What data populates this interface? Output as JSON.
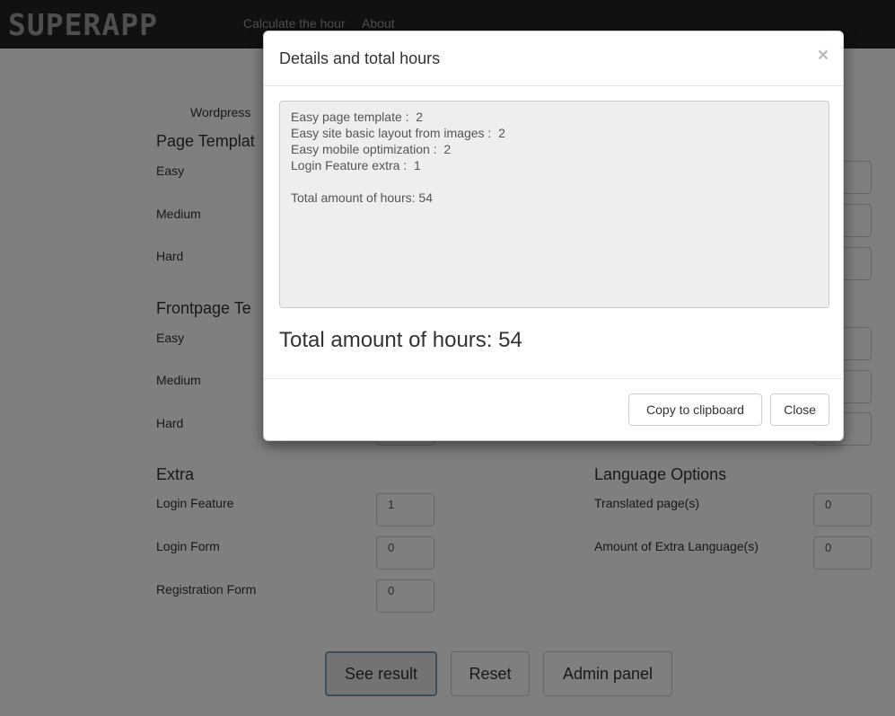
{
  "navbar": {
    "brand": "SUPERAPP",
    "links": [
      "Calculate the hour",
      "About"
    ]
  },
  "form": {
    "subtitle": "Wordpress",
    "sections": {
      "page_templates": {
        "title": "Page Templat",
        "rows": [
          "Easy",
          "Medium",
          "Hard"
        ]
      },
      "frontpage_templates": {
        "title": "Frontpage Te",
        "rows": [
          "Easy",
          "Medium",
          "Hard"
        ]
      },
      "extra": {
        "title": "Extra",
        "rows": [
          {
            "label": "Login Feature",
            "value": "1"
          },
          {
            "label": "Login Form",
            "value": "0"
          },
          {
            "label": "Registration Form",
            "value": "0"
          }
        ]
      },
      "language": {
        "title": "Language Options",
        "rows": [
          {
            "label": "Translated page(s)",
            "value": "0"
          },
          {
            "label": "Amount of Extra Language(s)",
            "value": "0"
          }
        ]
      }
    },
    "buttons": {
      "see_result": "See result",
      "reset": "Reset",
      "admin": "Admin panel"
    }
  },
  "modal": {
    "title": "Details and total hours",
    "close_glyph": "×",
    "details": [
      "Easy page template :  2",
      "Easy site basic layout from images :  2",
      "Easy mobile optimization :  2",
      "Login Feature extra :  1"
    ],
    "details_total": "Total amount of hours: 54",
    "total_big": "Total amount of hours: 54",
    "buttons": {
      "copy": "Copy to clipboard",
      "close": "Close"
    }
  }
}
